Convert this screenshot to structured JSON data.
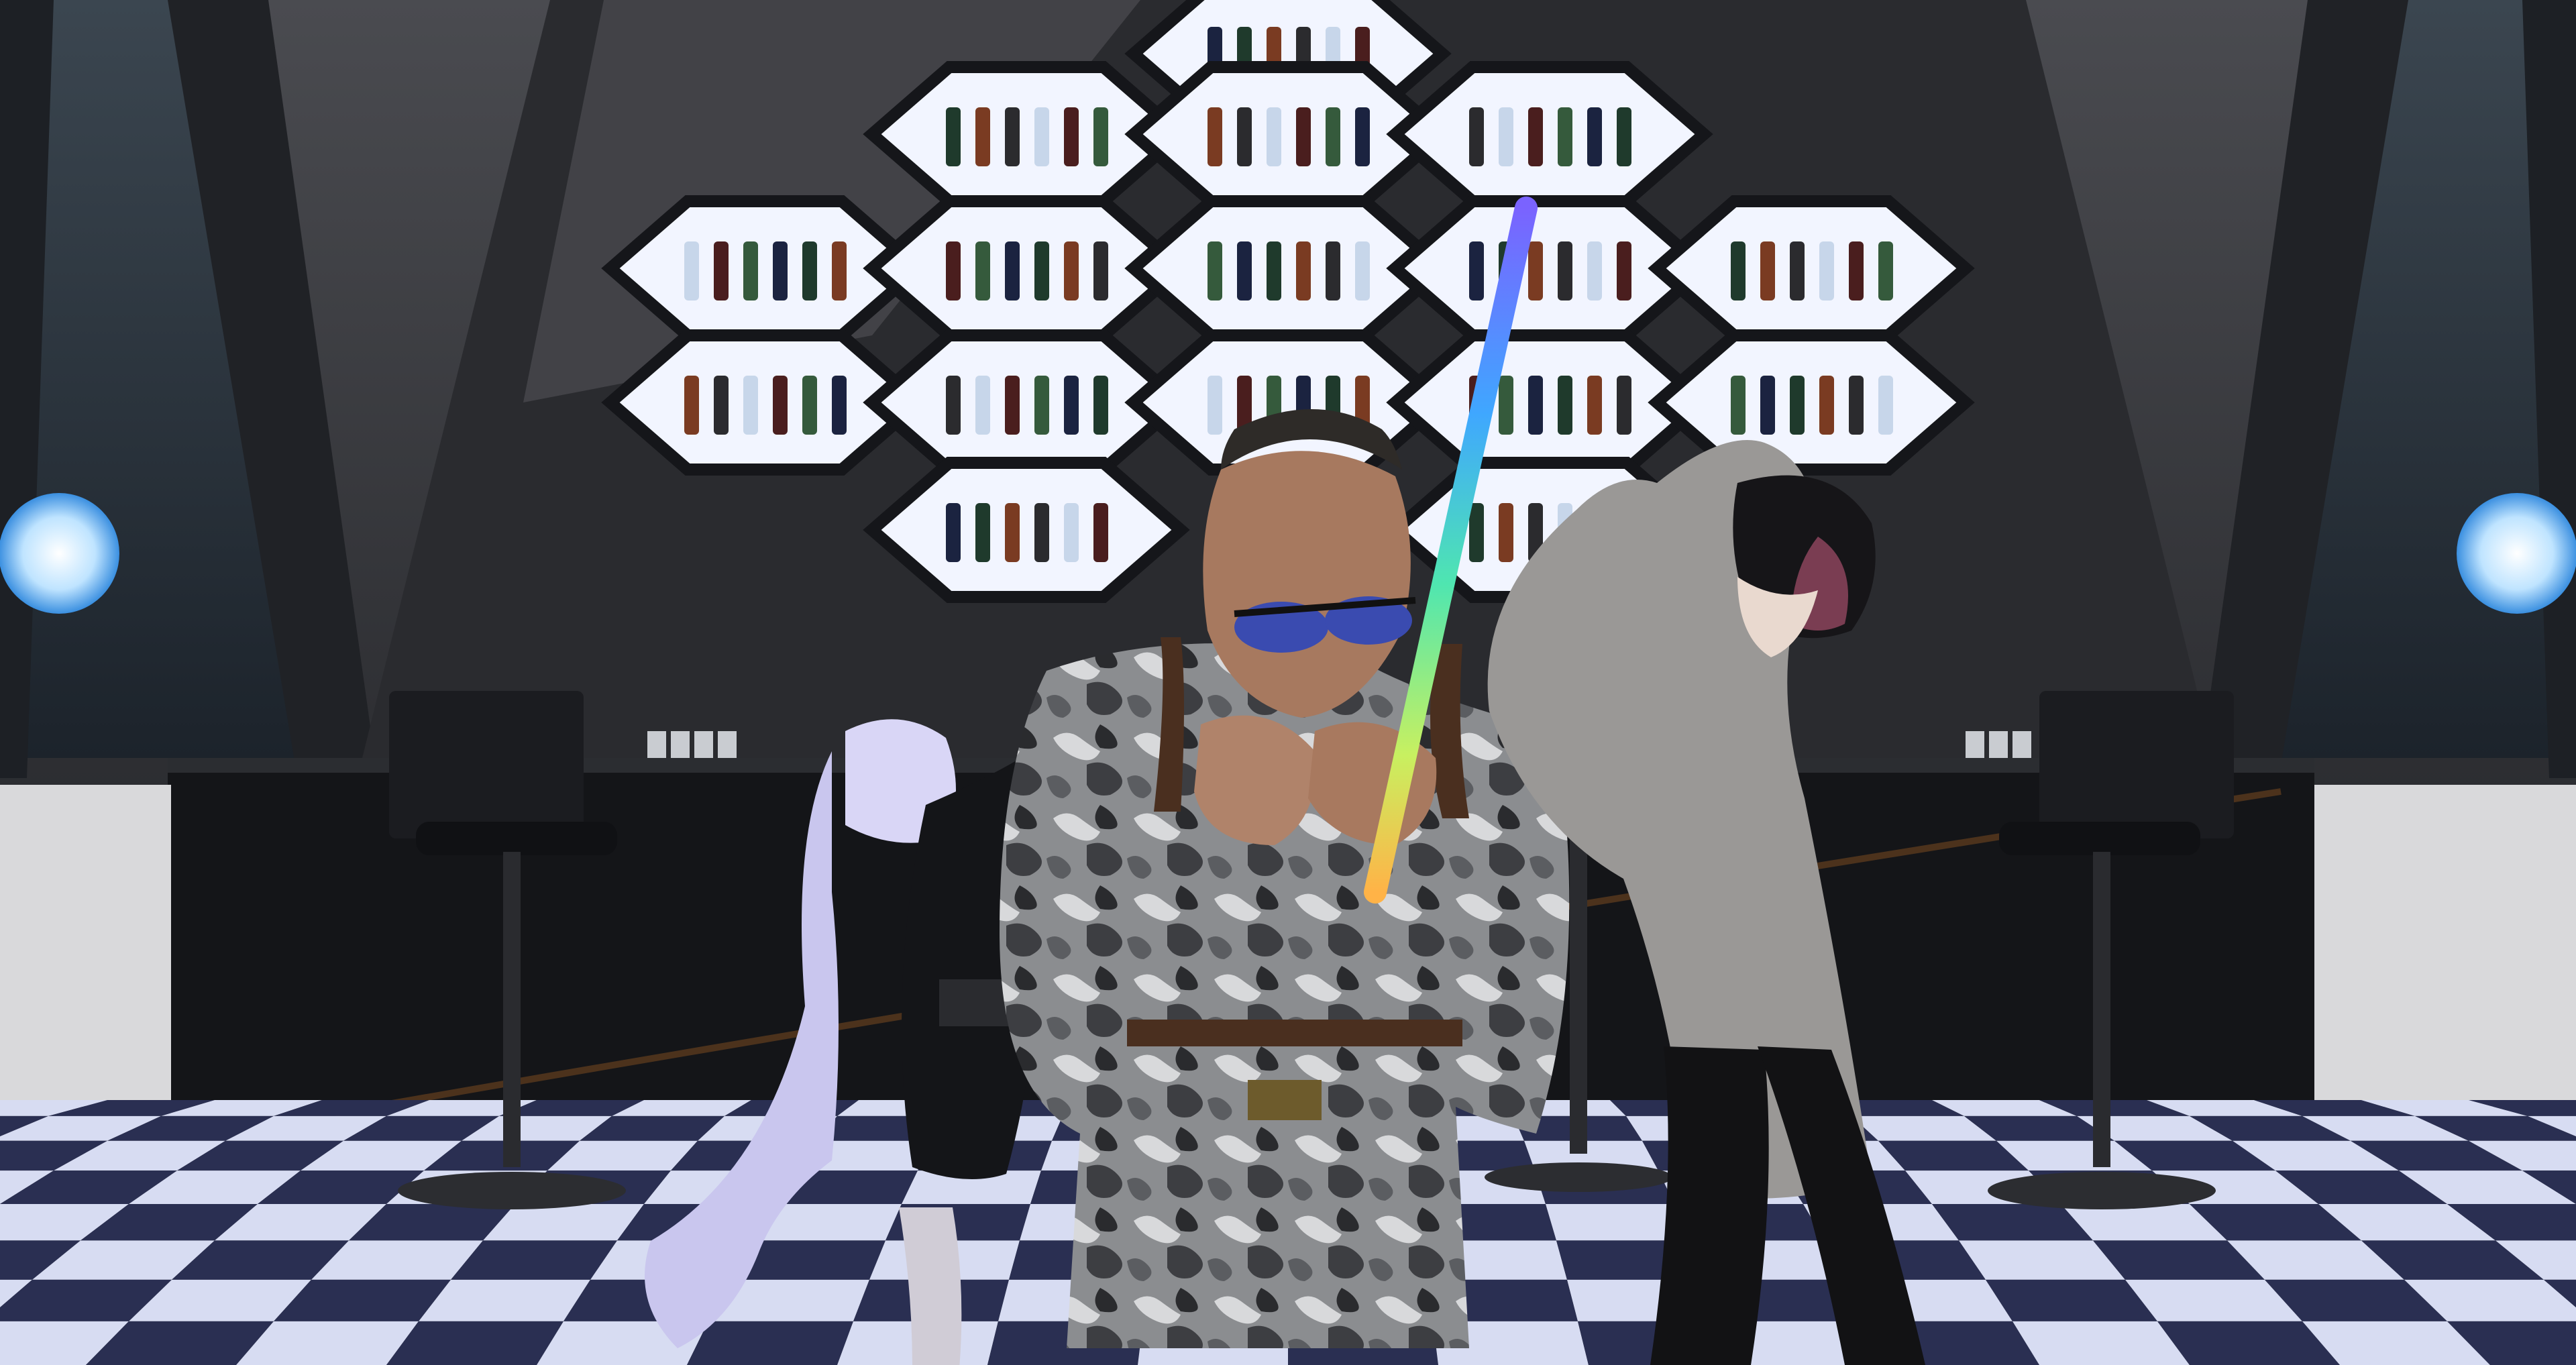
{
  "scene": {
    "kind": "vr-social-bar-screenshot",
    "ui_text": []
  },
  "palette": {
    "wall": "#3a3b3f",
    "wall_dark": "#1b1c20",
    "shelf_glow": "#f4f7ff",
    "shelf_frame": "#15161a",
    "floor_light": "#d7dcf2",
    "floor_dark": "#2a2f52",
    "orb": "#cfe9ff",
    "rainbow_stick": [
      "#7a63ff",
      "#3fa7ff",
      "#4fe6b0",
      "#c8f060",
      "#ffb347"
    ]
  },
  "characters": [
    {
      "id": "left-avatar",
      "hair": "lavender",
      "outfit": "black-hoodie"
    },
    {
      "id": "center-avatar",
      "outfit": "grey-camo",
      "accessory": "blue-sunglasses"
    },
    {
      "id": "right-avatar",
      "hair": "black-pink",
      "outfit": "grey-cardigan"
    }
  ]
}
